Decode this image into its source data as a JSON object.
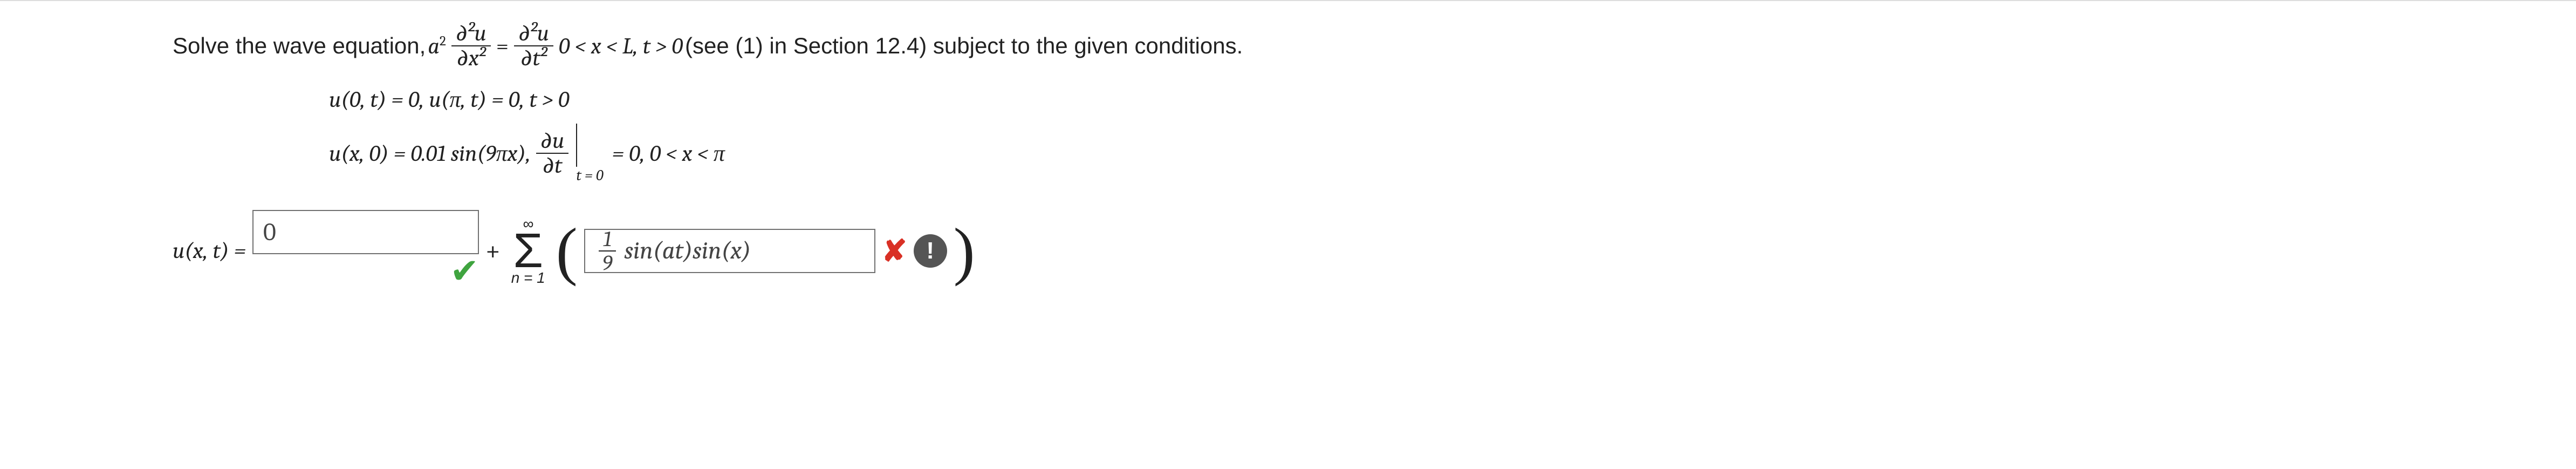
{
  "problem": {
    "intro_a": "Solve the wave equation, ",
    "coef": "a",
    "coef_exp": "2",
    "lhs_num": "∂²u",
    "lhs_den": "∂x²",
    "eq": " = ",
    "rhs_num": "∂²u",
    "rhs_den": "∂t²",
    "domain": " 0 < x < L, t > 0 ",
    "intro_b": "(see (1) in Section 12.4) subject to the given conditions."
  },
  "bc": {
    "l1": "u(0, t) = 0,   u(π, t) = 0,   t > 0",
    "l2a": "u(x, 0) = 0.01 sin(9πx),   ",
    "frac_num": "∂u",
    "frac_den": "∂t",
    "sub": "t = 0",
    "l2b": " = 0,   0 < x < π"
  },
  "answer": {
    "lhs": "u(x, t) = ",
    "box1": "0",
    "plus": " + ",
    "sigma_top": "∞",
    "sigma": "Σ",
    "sigma_bot": "n = 1",
    "lp": "(",
    "frac_top": "1",
    "frac_bot": "9",
    "body": "sin(at)sin(x)",
    "rp": ")",
    "alert": "!"
  },
  "chart_data": null
}
